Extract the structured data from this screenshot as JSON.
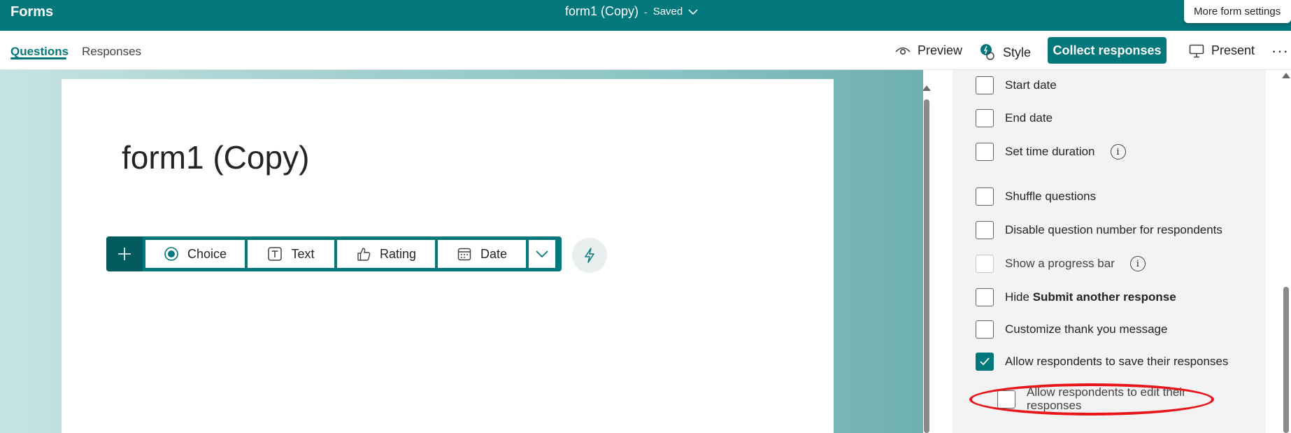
{
  "header": {
    "app_name": "Forms",
    "doc_title": "form1 (Copy)",
    "separator": "-",
    "status": "Saved",
    "tooltip": "More form settings"
  },
  "tabs": [
    {
      "label": "Questions",
      "active": true
    },
    {
      "label": "Responses",
      "active": false
    }
  ],
  "actions": {
    "preview": "Preview",
    "style": "Style",
    "collect": "Collect responses",
    "present": "Present",
    "more": "···"
  },
  "form": {
    "title": "form1 (Copy)"
  },
  "question_toolbar": {
    "add": "+",
    "choice": "Choice",
    "text": "Text",
    "rating": "Rating",
    "date": "Date"
  },
  "settings": [
    {
      "label": "Start date",
      "checked": false
    },
    {
      "label": "End date",
      "checked": false
    },
    {
      "label": "Set time duration",
      "checked": false,
      "info": true
    },
    {
      "label": "Shuffle questions",
      "checked": false
    },
    {
      "label": "Disable question number for respondents",
      "checked": false
    },
    {
      "label": "Show a progress bar",
      "checked": false,
      "disabled": true,
      "info": true
    },
    {
      "label_prefix": "Hide ",
      "label_bold": "Submit another response",
      "checked": false
    },
    {
      "label": "Customize thank you message",
      "checked": false
    },
    {
      "label": "Allow respondents to save their responses",
      "checked": true
    },
    {
      "label": "Allow respondents to edit their responses",
      "checked": false
    }
  ],
  "colors": {
    "brand": "#03787c",
    "annotation": "#e8161b"
  }
}
